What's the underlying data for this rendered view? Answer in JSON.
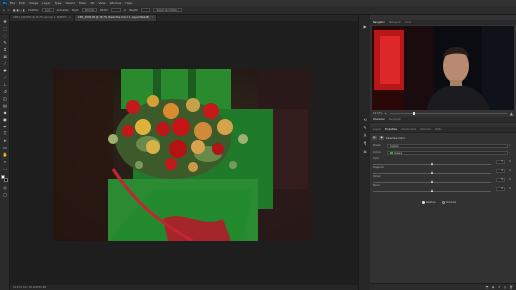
{
  "app": {
    "logo": "Ps",
    "menu": [
      "File",
      "Edit",
      "Image",
      "Layer",
      "Type",
      "Select",
      "Filter",
      "3D",
      "View",
      "Window",
      "Help"
    ]
  },
  "options": {
    "items": [
      "Feather:",
      "0 px",
      "Anti-alias",
      "Style:",
      "Normal",
      "Width:",
      "Height:",
      "Select and Mask..."
    ]
  },
  "tabs": [
    {
      "label": "CM11_00CZD2 @ 16.7% (Group 1, RGB/8*)",
      "active": false
    },
    {
      "label": "CM1_2025-00 @ 16.7% (Selective Color 1, Layer Mask/8)",
      "active": true
    }
  ],
  "status": {
    "text": "16.67%   Doc: 65.2M/530.4M"
  },
  "panel": {
    "top_tabs": [
      "Navigator",
      "Histogram",
      "Color"
    ],
    "zoom_label": "16.67%",
    "char_tabs": [
      "Character",
      "Paragraph"
    ],
    "prop_tabs": [
      "Layers",
      "Properties",
      "Adjustments",
      "Channels",
      "Paths"
    ],
    "adjustment_title": "Selective Color",
    "preset_label": "Preset:",
    "preset_value": "Custom",
    "colors_label": "Colors:",
    "colors_value": "Greens",
    "sliders": [
      {
        "name": "Cyan:",
        "value": "0"
      },
      {
        "name": "Magenta:",
        "value": "0"
      },
      {
        "name": "Yellow:",
        "value": "0"
      },
      {
        "name": "Black:",
        "value": "0"
      }
    ],
    "pct": "%",
    "methods": [
      {
        "label": "Relative",
        "selected": true
      },
      {
        "label": "Absolute",
        "selected": false
      }
    ]
  },
  "colors": {
    "accent_green": "#2fa84a",
    "webcam_red": "#d11a1a"
  }
}
